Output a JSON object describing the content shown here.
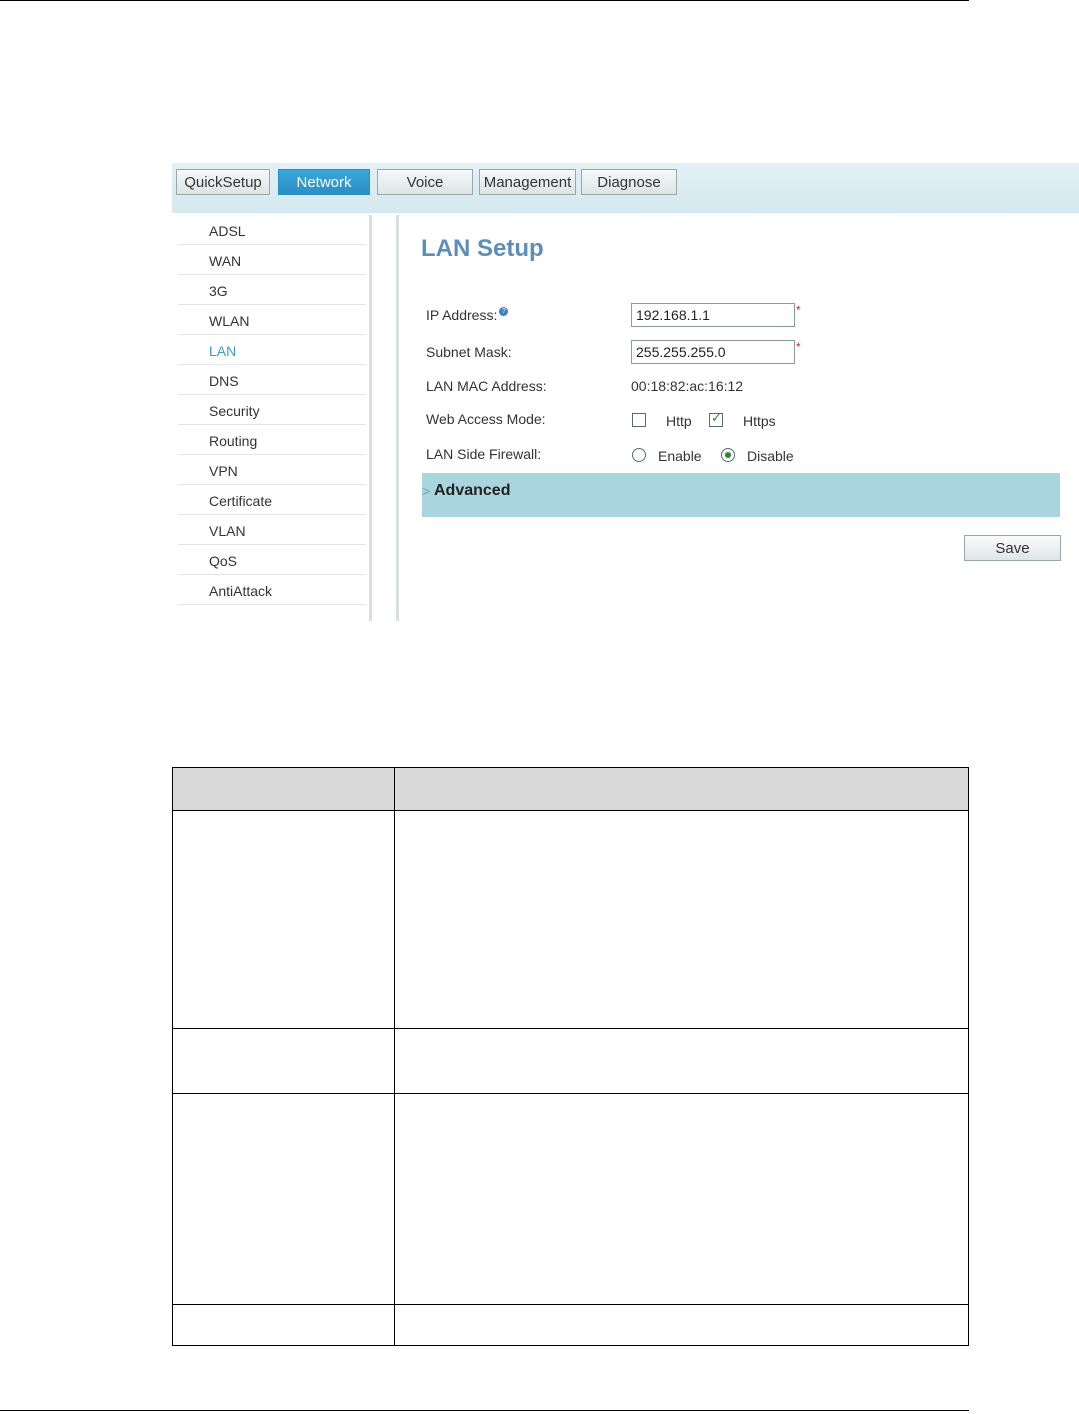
{
  "tabs": [
    {
      "label": "QuickSetup",
      "active": false
    },
    {
      "label": "Network",
      "active": true
    },
    {
      "label": "Voice",
      "active": false
    },
    {
      "label": "Management",
      "active": false
    },
    {
      "label": "Diagnose",
      "active": false
    }
  ],
  "sidebar": {
    "items": [
      {
        "label": "ADSL",
        "active": false
      },
      {
        "label": "WAN",
        "active": false
      },
      {
        "label": "3G",
        "active": false
      },
      {
        "label": "WLAN",
        "active": false
      },
      {
        "label": "LAN",
        "active": true
      },
      {
        "label": "DNS",
        "active": false
      },
      {
        "label": "Security",
        "active": false
      },
      {
        "label": "Routing",
        "active": false
      },
      {
        "label": "VPN",
        "active": false
      },
      {
        "label": "Certificate",
        "active": false
      },
      {
        "label": "VLAN",
        "active": false
      },
      {
        "label": "QoS",
        "active": false
      },
      {
        "label": "AntiAttack",
        "active": false
      }
    ]
  },
  "content": {
    "title": "LAN Setup",
    "ip_address": {
      "label": "IP Address:",
      "value": "192.168.1.1",
      "required_mark": "*"
    },
    "subnet_mask": {
      "label": "Subnet Mask:",
      "value": "255.255.255.0",
      "required_mark": "*"
    },
    "lan_mac": {
      "label": "LAN MAC Address:",
      "value": "00:18:82:ac:16:12"
    },
    "web_access_mode": {
      "label": "Web Access Mode:",
      "http": {
        "label": "Http",
        "checked": false
      },
      "https": {
        "label": "Https",
        "checked": true
      }
    },
    "lan_side_firewall": {
      "label": "LAN Side Firewall:",
      "enable": {
        "label": "Enable",
        "selected": false
      },
      "disable": {
        "label": "Disable",
        "selected": true
      }
    },
    "advanced": {
      "chevron": ">",
      "label": "Advanced"
    },
    "save_label": "Save",
    "help_glyph": "?",
    "check_glyph": "✓"
  },
  "colors": {
    "active_tab": "#2a8fc4",
    "active_sidebar": "#3a9ec8",
    "title": "#5b8fb8",
    "advanced_bar": "#a9d6de",
    "checkmark": "#2a8a2a"
  },
  "doc_table": {
    "header": [
      "",
      ""
    ],
    "rows": [
      [
        "",
        ""
      ],
      [
        "",
        ""
      ],
      [
        "",
        ""
      ],
      [
        "",
        ""
      ]
    ]
  }
}
